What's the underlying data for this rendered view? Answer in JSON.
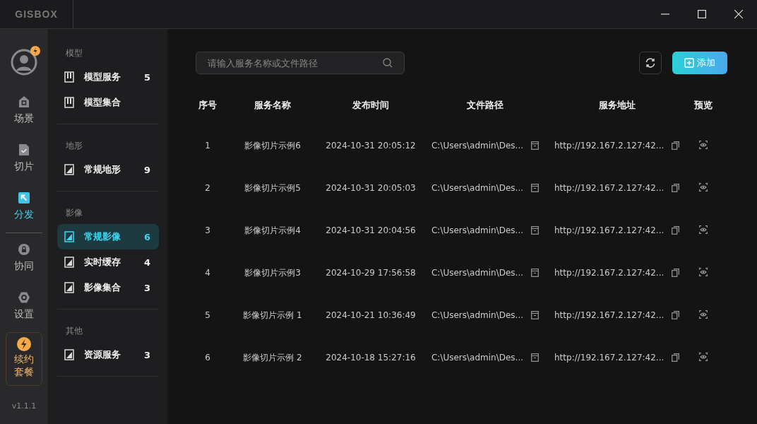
{
  "window": {
    "logo": "GISBOX"
  },
  "rail": {
    "items": [
      {
        "label": "场景",
        "selected": false
      },
      {
        "label": "切片",
        "selected": false
      },
      {
        "label": "分发",
        "selected": true
      },
      {
        "label": "协同",
        "selected": false,
        "divider_before": true
      },
      {
        "label": "设置",
        "selected": false
      }
    ],
    "renew": {
      "label": "续约套餐"
    },
    "version": "v1.1.1"
  },
  "sidebar": {
    "groups": [
      {
        "title": "模型",
        "items": [
          {
            "label": "模型服务",
            "count": "5",
            "selected": false
          },
          {
            "label": "模型集合",
            "selected": false
          }
        ]
      },
      {
        "title": "地形",
        "items": [
          {
            "label": "常规地形",
            "count": "9",
            "selected": false
          }
        ]
      },
      {
        "title": "影像",
        "items": [
          {
            "label": "常规影像",
            "count": "6",
            "selected": true
          },
          {
            "label": "实时缓存",
            "count": "4",
            "selected": false
          },
          {
            "label": "影像集合",
            "count": "3",
            "selected": false
          }
        ]
      },
      {
        "title": "其他",
        "items": [
          {
            "label": "资源服务",
            "count": "3",
            "selected": false
          }
        ]
      }
    ]
  },
  "search": {
    "placeholder": "请输入服务名称或文件路径"
  },
  "add_button": "添加",
  "table": {
    "columns": [
      "序号",
      "服务名称",
      "发布时间",
      "文件路径",
      "服务地址",
      "预览"
    ],
    "rows": [
      [
        "1",
        "影像切片示例6",
        "2024-10-31 20:05:12",
        "C:\\Users\\admin\\Des...",
        "http://192.167.2.127:42..."
      ],
      [
        "2",
        "影像切片示例5",
        "2024-10-31 20:05:03",
        "C:\\Users\\admin\\Des...",
        "http://192.167.2.127:42..."
      ],
      [
        "3",
        "影像切片示例4",
        "2024-10-31 20:04:56",
        "C:\\Users\\admin\\Des...",
        "http://192.167.2.127:42..."
      ],
      [
        "4",
        "影像切片示例3",
        "2024-10-29 17:56:58",
        "C:\\Users\\admin\\Des...",
        "http://192.167.2.127:42..."
      ],
      [
        "5",
        "影像切片示例 1",
        "2024-10-21 10:36:49",
        "C:\\Users\\admin\\Des...",
        "http://192.167.2.127:42..."
      ],
      [
        "6",
        "影像切片示例 2",
        "2024-10-18 15:27:16",
        "C:\\Users\\admin\\Des...",
        "http://192.167.2.127:42..."
      ]
    ]
  }
}
